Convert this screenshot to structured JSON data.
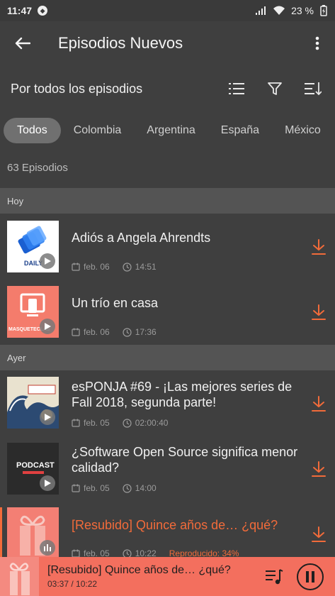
{
  "status": {
    "time": "11:47",
    "battery": "23 %"
  },
  "appbar": {
    "title": "Episodios Nuevos"
  },
  "toolbar": {
    "sort_label": "Por todos los episodios"
  },
  "chips": [
    "Todos",
    "Colombia",
    "Argentina",
    "España",
    "México"
  ],
  "count": "63 Episodios",
  "sections": [
    {
      "label": "Hoy"
    },
    {
      "label": "Ayer"
    }
  ],
  "episodes": [
    {
      "title": "Adiós a Angela Ahrendts",
      "date": "feb. 06",
      "duration": "14:51",
      "thumb_text": "DAILY"
    },
    {
      "title": "Un trío en casa",
      "date": "feb. 06",
      "duration": "17:36",
      "thumb_text": "MASQUETECLAS"
    },
    {
      "title": "esPONJA #69 - ¡Las mejores series de Fall 2018, segunda parte!",
      "date": "feb. 05",
      "duration": "02:00:40",
      "thumb_text": ""
    },
    {
      "title": "¿Software Open Source significa menor calidad?",
      "date": "feb. 05",
      "duration": "14:00",
      "thumb_text": "PODCAST"
    },
    {
      "title": "[Resubido] Quince años de… ¿qué?",
      "date": "feb. 05",
      "duration": "10:22",
      "progress": "Reproducido: 34%"
    }
  ],
  "player": {
    "title": "[Resubido] Quince años de… ¿qué?",
    "time": "03:37 / 10:22"
  },
  "colors": {
    "accent": "#f26b3a",
    "background": "#3f3f3f",
    "section": "#545454",
    "player": "#f36f5e"
  }
}
